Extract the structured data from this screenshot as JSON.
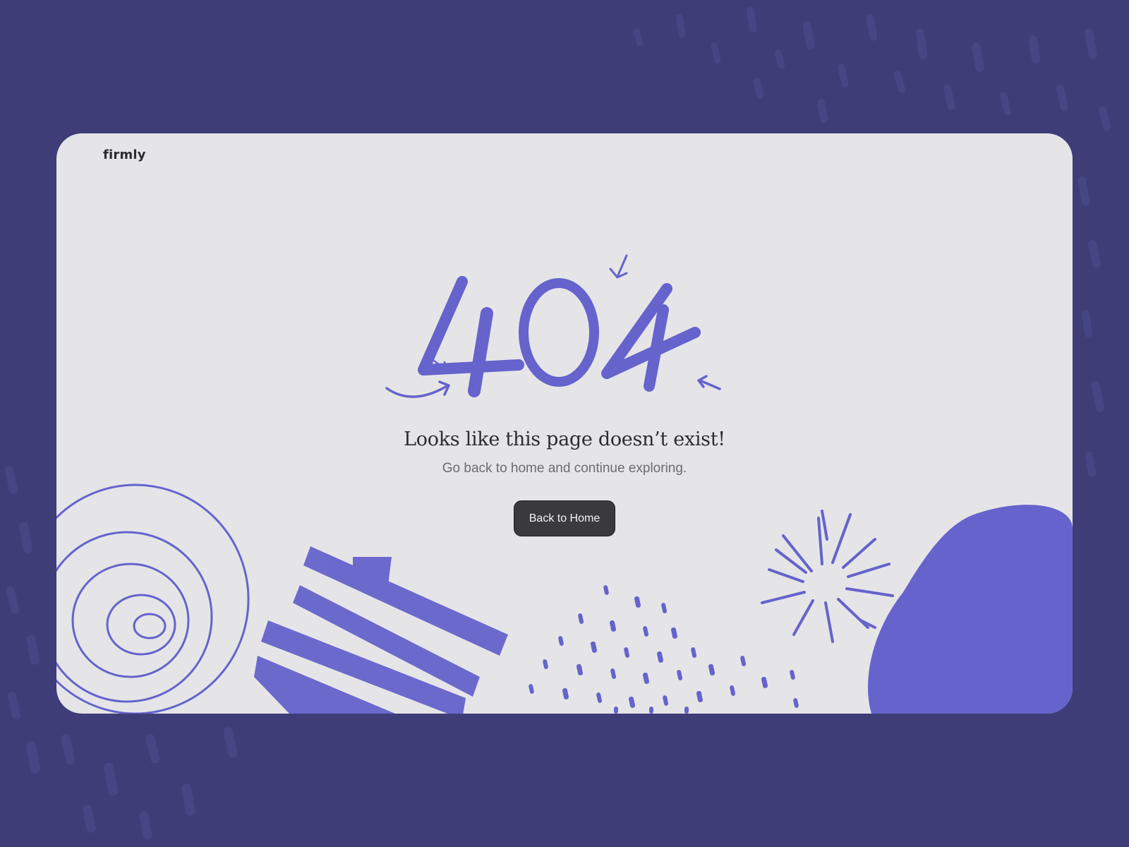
{
  "brand": {
    "logo": "firmly"
  },
  "error": {
    "code": "404",
    "headline": "Looks like this page doesn’t exist!",
    "subline": "Go back to home and continue exploring."
  },
  "actions": {
    "home_button": "Back to Home"
  },
  "colors": {
    "page_background": "#3e3d78",
    "card_background": "#e5e5e8",
    "accent": "#6663cc",
    "button_background": "#3a3a3c",
    "button_text": "#f4f4f6",
    "headline_text": "#2c2c30",
    "subline_text": "#6b6b70"
  }
}
